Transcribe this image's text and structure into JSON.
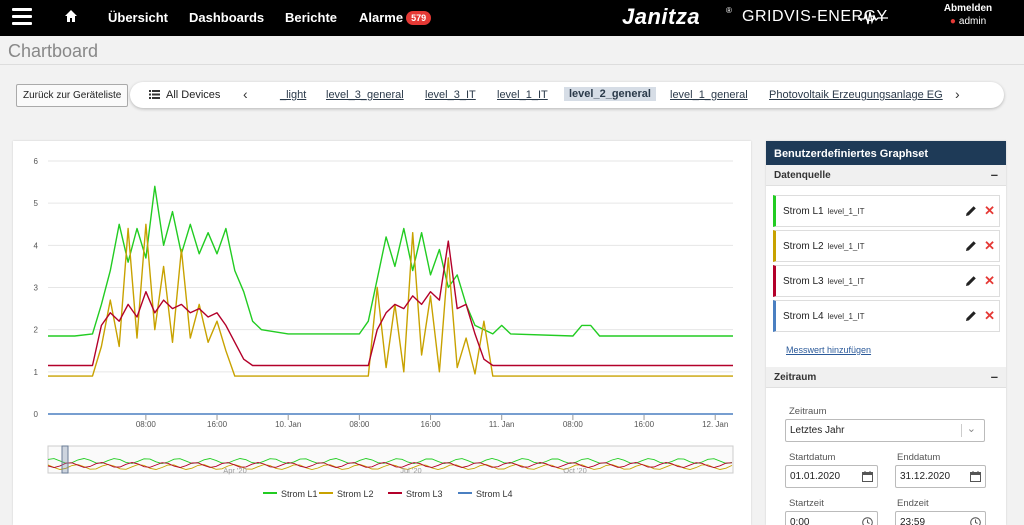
{
  "nav": {
    "items": [
      "Übersicht",
      "Dashboards",
      "Berichte",
      "Alarme"
    ],
    "alarm_count": "579",
    "brand": "Janitza",
    "brand_mark": "®",
    "brand_sub": "GRIDVIS-ENERGY",
    "logout": "Abmelden",
    "user": "admin",
    "icons": [
      "hamburger-icon",
      "home-icon",
      "user-icon",
      "pulse-wave-icon"
    ]
  },
  "page": {
    "title": "Chartboard"
  },
  "toolbar": {
    "back": "Zurück zur Geräteliste",
    "all_devices": "All Devices",
    "devices": [
      "_light",
      "level_3_general",
      "level_3_IT",
      "level_1_IT",
      "level_2_general",
      "level_1_general",
      "Photovoltaik Erzeugungsanlage EG"
    ],
    "active_device": "level_2_general"
  },
  "chart_data": {
    "type": "line",
    "ylim": [
      0,
      6
    ],
    "yticks": [
      "0",
      "1",
      "2",
      "3",
      "4",
      "5",
      "6"
    ],
    "xticks": [
      "08:00",
      "16:00",
      "10. Jan",
      "08:00",
      "16:00",
      "11. Jan",
      "08:00",
      "16:00",
      "12. Jan"
    ],
    "x_unit_hours": [
      8,
      16,
      24,
      32,
      40,
      48,
      56,
      64,
      72
    ],
    "x_range_hours": [
      -3,
      74
    ],
    "navigator_labels": [
      "Apr '20",
      "Jul '20",
      "Oct '20"
    ],
    "series": [
      {
        "name": "Strom L1",
        "color": "#22cc22",
        "points": [
          [
            -3,
            1.85
          ],
          [
            0,
            1.85
          ],
          [
            2,
            1.9
          ],
          [
            3,
            2.6
          ],
          [
            4,
            3.4
          ],
          [
            5,
            4.5
          ],
          [
            6,
            3.6
          ],
          [
            7,
            4.4
          ],
          [
            8,
            3.7
          ],
          [
            9,
            5.4
          ],
          [
            10,
            4.0
          ],
          [
            11,
            4.8
          ],
          [
            12,
            3.8
          ],
          [
            13,
            4.5
          ],
          [
            14,
            3.8
          ],
          [
            15,
            4.3
          ],
          [
            16,
            3.8
          ],
          [
            17,
            4.4
          ],
          [
            18,
            3.4
          ],
          [
            19,
            2.9
          ],
          [
            20,
            2.2
          ],
          [
            21,
            2.0
          ],
          [
            24,
            1.9
          ],
          [
            32,
            1.9
          ],
          [
            33,
            2.2
          ],
          [
            34,
            3.2
          ],
          [
            35,
            4.2
          ],
          [
            36,
            3.5
          ],
          [
            37,
            4.4
          ],
          [
            38,
            3.4
          ],
          [
            39,
            4.3
          ],
          [
            40,
            3.3
          ],
          [
            41,
            3.9
          ],
          [
            42,
            3.0
          ],
          [
            43,
            3.3
          ],
          [
            44,
            2.6
          ],
          [
            45,
            2.1
          ],
          [
            47,
            1.9
          ],
          [
            48,
            2.1
          ],
          [
            49,
            1.9
          ],
          [
            56,
            1.85
          ],
          [
            57,
            2.1
          ],
          [
            58,
            2.1
          ],
          [
            59,
            1.85
          ],
          [
            74,
            1.85
          ]
        ]
      },
      {
        "name": "Strom L2",
        "color": "#c8a200",
        "points": [
          [
            -3,
            0.9
          ],
          [
            2,
            0.9
          ],
          [
            3,
            1.6
          ],
          [
            4,
            2.7
          ],
          [
            5,
            1.6
          ],
          [
            6,
            4.4
          ],
          [
            7,
            1.8
          ],
          [
            8,
            4.5
          ],
          [
            9,
            2.0
          ],
          [
            10,
            3.5
          ],
          [
            11,
            1.7
          ],
          [
            12,
            3.9
          ],
          [
            13,
            1.8
          ],
          [
            14,
            2.6
          ],
          [
            15,
            1.7
          ],
          [
            16,
            2.2
          ],
          [
            17,
            1.5
          ],
          [
            18,
            0.9
          ],
          [
            33,
            0.9
          ],
          [
            34,
            3.0
          ],
          [
            35,
            1.1
          ],
          [
            36,
            2.6
          ],
          [
            37,
            1.0
          ],
          [
            38,
            4.3
          ],
          [
            39,
            1.4
          ],
          [
            40,
            2.8
          ],
          [
            41,
            1.0
          ],
          [
            42,
            3.7
          ],
          [
            43,
            1.1
          ],
          [
            44,
            1.8
          ],
          [
            45,
            0.95
          ],
          [
            46,
            2.2
          ],
          [
            47,
            0.9
          ],
          [
            74,
            0.9
          ]
        ]
      },
      {
        "name": "Strom L3",
        "color": "#b3002a",
        "points": [
          [
            -3,
            1.15
          ],
          [
            2,
            1.15
          ],
          [
            3,
            2.1
          ],
          [
            4,
            2.4
          ],
          [
            5,
            2.2
          ],
          [
            6,
            2.6
          ],
          [
            7,
            2.3
          ],
          [
            8,
            2.9
          ],
          [
            9,
            2.4
          ],
          [
            10,
            2.7
          ],
          [
            11,
            2.5
          ],
          [
            12,
            2.6
          ],
          [
            13,
            2.4
          ],
          [
            14,
            2.5
          ],
          [
            15,
            2.3
          ],
          [
            16,
            2.4
          ],
          [
            17,
            2.1
          ],
          [
            18,
            1.7
          ],
          [
            19,
            1.3
          ],
          [
            20,
            1.15
          ],
          [
            33,
            1.15
          ],
          [
            34,
            2.0
          ],
          [
            35,
            2.4
          ],
          [
            36,
            2.6
          ],
          [
            37,
            2.5
          ],
          [
            38,
            2.8
          ],
          [
            39,
            2.6
          ],
          [
            40,
            2.9
          ],
          [
            41,
            2.7
          ],
          [
            42,
            4.1
          ],
          [
            43,
            2.5
          ],
          [
            44,
            2.6
          ],
          [
            45,
            1.9
          ],
          [
            46,
            1.3
          ],
          [
            47,
            1.15
          ],
          [
            74,
            1.15
          ]
        ]
      },
      {
        "name": "Strom L4",
        "color": "#4a7fc1",
        "points": [
          [
            -3,
            0.0
          ],
          [
            74,
            0.0
          ]
        ]
      }
    ]
  },
  "panel": {
    "title": "Benutzerdefiniertes Graphset",
    "datasource_label": "Datenquelle",
    "datasources": [
      {
        "name": "Strom L1",
        "device": "level_1_IT",
        "color": "#22cc22"
      },
      {
        "name": "Strom L2",
        "device": "level_1_IT",
        "color": "#c8a200"
      },
      {
        "name": "Strom L3",
        "device": "level_1_IT",
        "color": "#b3002a"
      },
      {
        "name": "Strom L4",
        "device": "level_1_IT",
        "color": "#4a7fc1"
      }
    ],
    "add_value": "Messwert hinzufügen",
    "timerange_label": "Zeitraum",
    "field_zeitraum": "Zeitraum",
    "zeitraum_value": "Letztes Jahr",
    "start_date_label": "Startdatum",
    "start_date": "01.01.2020",
    "end_date_label": "Enddatum",
    "end_date": "31.12.2020",
    "start_time_label": "Startzeit",
    "start_time": "0:00",
    "end_time_label": "Endzeit",
    "end_time": "23:59"
  }
}
